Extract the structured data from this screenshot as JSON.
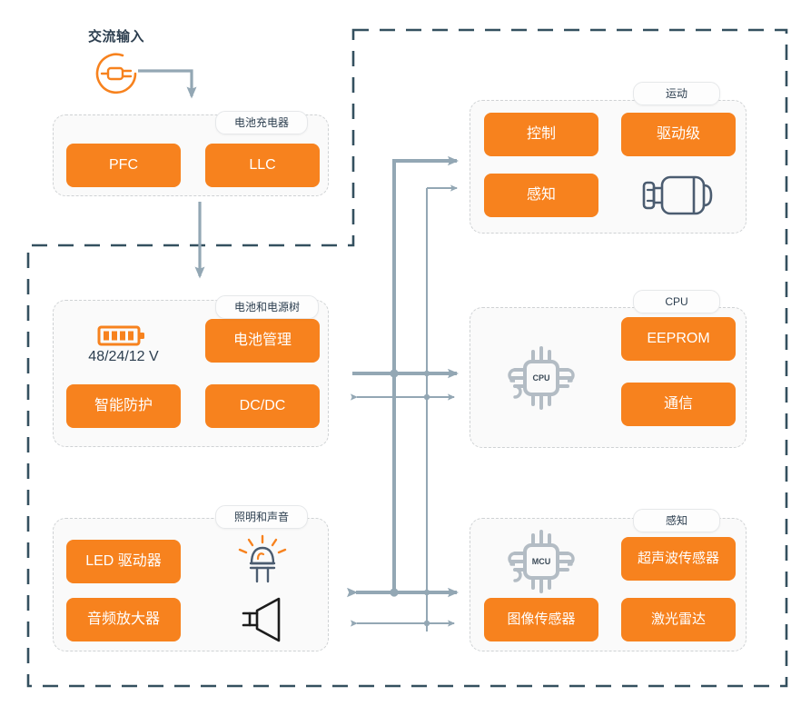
{
  "diagram": {
    "title_ac_input": "交流输入",
    "colors": {
      "orange": "#f7821e",
      "outline_dark": "#34505f",
      "bus_line": "#93a7b4",
      "panel_border": "#cfd2d4",
      "panel_fill": "#fafafa",
      "text_dark": "#2c3e4f"
    },
    "icons": {
      "ac_plug": "ac-power-plug-icon",
      "battery": "battery-icon",
      "motor": "motor-icon",
      "cpu_chip": "cpu-chip-icon",
      "mcu_chip": "mcu-chip-icon",
      "led": "led-lamp-icon",
      "speaker": "speaker-icon",
      "arrow_down": "arrow-down-icon"
    },
    "chip_labels": {
      "cpu": "CPU",
      "mcu": "MCU"
    },
    "battery_caption": "48/24/12 V",
    "panels": [
      {
        "id": "battery-charger",
        "label": "电池充电器",
        "blocks": [
          {
            "id": "pfc",
            "label": "PFC"
          },
          {
            "id": "llc",
            "label": "LLC"
          }
        ]
      },
      {
        "id": "battery-power-tree",
        "label": "电池和电源树",
        "blocks": [
          {
            "id": "battery-management",
            "label": "电池管理"
          },
          {
            "id": "smart-protection",
            "label": "智能防护"
          },
          {
            "id": "dcdc",
            "label": "DC/DC"
          }
        ]
      },
      {
        "id": "lighting-sound",
        "label": "照明和声音",
        "blocks": [
          {
            "id": "led-driver",
            "label": "LED 驱动器"
          },
          {
            "id": "audio-amplifier",
            "label": "音频放大器"
          }
        ]
      },
      {
        "id": "motion",
        "label": "运动",
        "blocks": [
          {
            "id": "control",
            "label": "控制"
          },
          {
            "id": "drive-stage",
            "label": "驱动级"
          },
          {
            "id": "sensing-motion",
            "label": "感知"
          }
        ]
      },
      {
        "id": "cpu",
        "label": "CPU",
        "blocks": [
          {
            "id": "eeprom",
            "label": "EEPROM"
          },
          {
            "id": "communication",
            "label": "通信"
          }
        ]
      },
      {
        "id": "perception",
        "label": "感知",
        "blocks": [
          {
            "id": "ultrasonic-sensor",
            "label": "超声波传感器"
          },
          {
            "id": "image-sensor",
            "label": "图像传感器"
          },
          {
            "id": "lidar",
            "label": "激光雷达"
          }
        ]
      }
    ]
  }
}
